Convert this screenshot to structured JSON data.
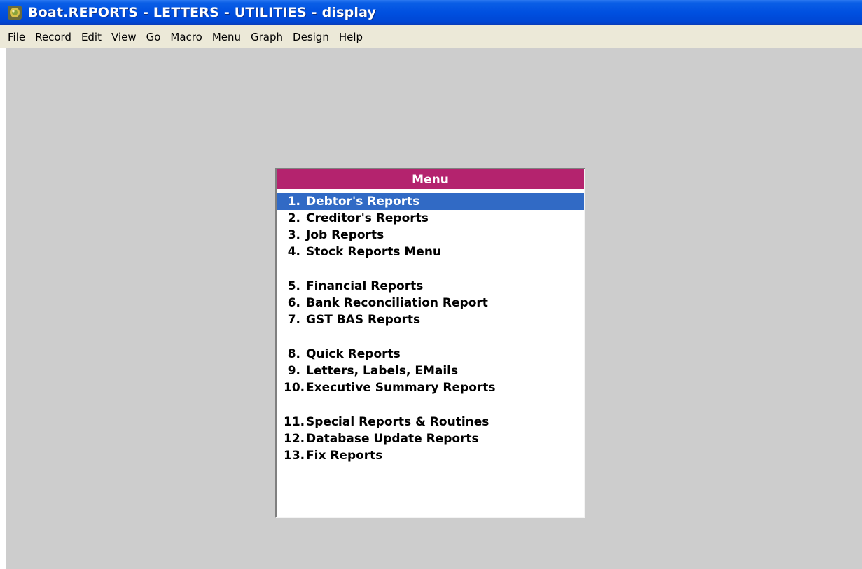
{
  "window": {
    "title": "Boat.REPORTS - LETTERS - UTILITIES - display",
    "icon": "app-icon"
  },
  "menubar": {
    "items": [
      "File",
      "Record",
      "Edit",
      "View",
      "Go",
      "Macro",
      "Menu",
      "Graph",
      "Design",
      "Help"
    ]
  },
  "menu_panel": {
    "header": "Menu",
    "selected_index": 0,
    "items": [
      {
        "num": "1.",
        "label": "Debtor's Reports"
      },
      {
        "num": "2.",
        "label": "Creditor's Reports"
      },
      {
        "num": "3.",
        "label": "Job Reports"
      },
      {
        "num": "4.",
        "label": "Stock Reports Menu"
      },
      {
        "num": "5.",
        "label": "Financial Reports"
      },
      {
        "num": "6.",
        "label": "Bank Reconciliation Report"
      },
      {
        "num": "7.",
        "label": "GST BAS Reports"
      },
      {
        "num": "8.",
        "label": "Quick Reports"
      },
      {
        "num": "9.",
        "label": "Letters, Labels, EMails"
      },
      {
        "num": "10.",
        "label": "Executive Summary Reports"
      },
      {
        "num": "11.",
        "label": "Special Reports & Routines"
      },
      {
        "num": "12.",
        "label": "Database Update Reports"
      },
      {
        "num": "13.",
        "label": "Fix Reports"
      }
    ]
  },
  "colors": {
    "titlebar": "#0050e0",
    "menubar": "#ece9d8",
    "client_bg": "#cdcdcd",
    "menu_header": "#b4236e",
    "selection": "#316ac5"
  }
}
